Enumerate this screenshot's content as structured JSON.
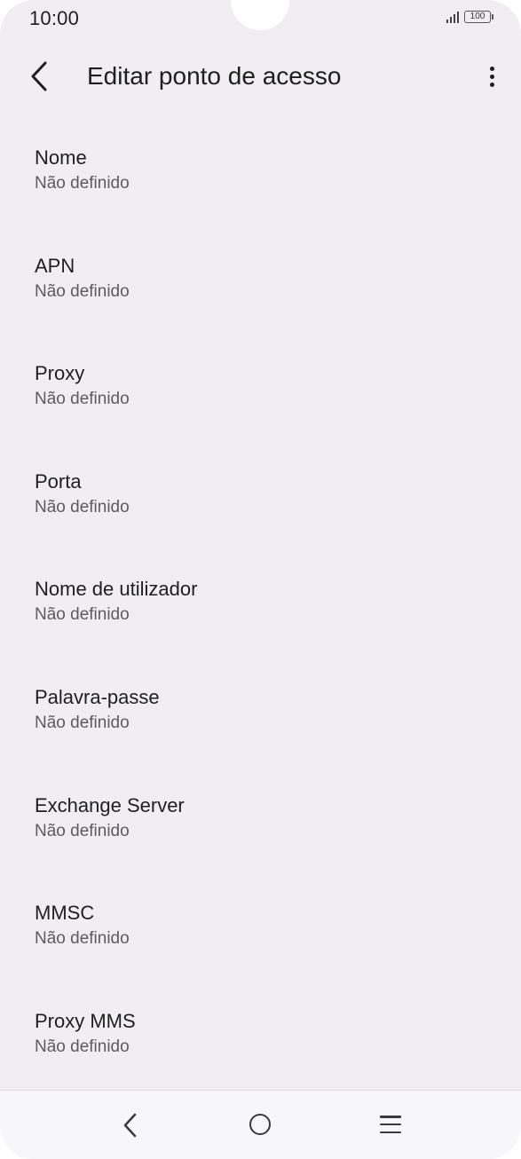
{
  "status_bar": {
    "time": "10:00",
    "battery": "100"
  },
  "header": {
    "title": "Editar ponto de acesso"
  },
  "settings": [
    {
      "title": "Nome",
      "value": "Não definido"
    },
    {
      "title": "APN",
      "value": "Não definido"
    },
    {
      "title": "Proxy",
      "value": "Não definido"
    },
    {
      "title": "Porta",
      "value": "Não definido"
    },
    {
      "title": "Nome de utilizador",
      "value": "Não definido"
    },
    {
      "title": "Palavra-passe",
      "value": "Não definido"
    },
    {
      "title": "Exchange Server",
      "value": "Não definido"
    },
    {
      "title": "MMSC",
      "value": "Não definido"
    },
    {
      "title": "Proxy MMS",
      "value": "Não definido"
    }
  ],
  "icons": {
    "back": "chevron-left-icon",
    "more": "more-vert-icon",
    "signal": "signal-icon",
    "battery": "battery-icon",
    "nav_back": "nav-back-icon",
    "nav_home": "nav-home-icon",
    "nav_recents": "nav-recents-icon"
  },
  "colors": {
    "background": "#f0eef1",
    "text_primary": "#1f1f1f",
    "text_secondary": "#5d5b60"
  }
}
